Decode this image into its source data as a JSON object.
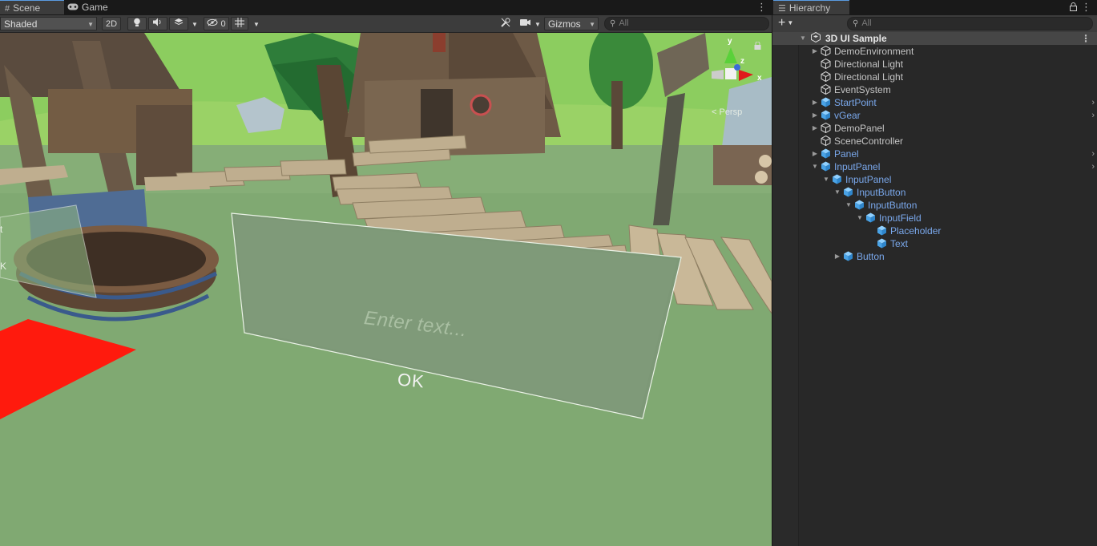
{
  "tabs": {
    "scene": "Scene",
    "game": "Game",
    "hierarchy": "Hierarchy"
  },
  "scene_toolbar": {
    "shading_mode": "Shaded",
    "toggle_2d": "2D",
    "hidden_count": "0",
    "gizmos": "Gizmos",
    "search_placeholder": "All"
  },
  "hierarchy_toolbar": {
    "add": "+",
    "search_placeholder": "All"
  },
  "viewport": {
    "input_placeholder_text": "Enter text...",
    "button_text": "OK",
    "camera_mode": "< Persp",
    "gizmo_axes": {
      "y": "y",
      "x": "x",
      "z": "z"
    },
    "left_panel_fragment_t": "t",
    "left_panel_fragment_k": "K"
  },
  "colors": {
    "accent": "#5a9be0",
    "prefab_text": "#7aa8ec",
    "ground": "#7fa870",
    "sky": "#8ccd5f",
    "red_plane": "#ff1a0d"
  },
  "hierarchy": {
    "scene_name": "3D UI Sample",
    "items": [
      {
        "name": "DemoEnvironment",
        "depth": 1,
        "foldout": "collapsed",
        "prefab": false,
        "arrow": false
      },
      {
        "name": "Directional Light",
        "depth": 1,
        "foldout": "none",
        "prefab": false,
        "arrow": false
      },
      {
        "name": "Directional Light",
        "depth": 1,
        "foldout": "none",
        "prefab": false,
        "arrow": false
      },
      {
        "name": "EventSystem",
        "depth": 1,
        "foldout": "none",
        "prefab": false,
        "arrow": false
      },
      {
        "name": "StartPoint",
        "depth": 1,
        "foldout": "collapsed",
        "prefab": true,
        "arrow": true
      },
      {
        "name": "vGear",
        "depth": 1,
        "foldout": "collapsed",
        "prefab": true,
        "arrow": true
      },
      {
        "name": "DemoPanel",
        "depth": 1,
        "foldout": "collapsed",
        "prefab": false,
        "arrow": false
      },
      {
        "name": "SceneController",
        "depth": 1,
        "foldout": "none",
        "prefab": false,
        "arrow": false
      },
      {
        "name": "Panel",
        "depth": 1,
        "foldout": "collapsed",
        "prefab": true,
        "arrow": true
      },
      {
        "name": "InputPanel",
        "depth": 1,
        "foldout": "expanded",
        "prefab": true,
        "arrow": true
      },
      {
        "name": "InputPanel",
        "depth": 2,
        "foldout": "expanded",
        "prefab": true,
        "arrow": false
      },
      {
        "name": "InputButton",
        "depth": 3,
        "foldout": "expanded",
        "prefab": true,
        "arrow": false
      },
      {
        "name": "InputButton",
        "depth": 4,
        "foldout": "expanded",
        "prefab": true,
        "arrow": false
      },
      {
        "name": "InputField",
        "depth": 5,
        "foldout": "expanded",
        "prefab": true,
        "arrow": false
      },
      {
        "name": "Placeholder",
        "depth": 6,
        "foldout": "none",
        "prefab": true,
        "arrow": false
      },
      {
        "name": "Text",
        "depth": 6,
        "foldout": "none",
        "prefab": true,
        "arrow": false
      },
      {
        "name": "Button",
        "depth": 3,
        "foldout": "collapsed",
        "prefab": true,
        "arrow": false
      }
    ]
  }
}
